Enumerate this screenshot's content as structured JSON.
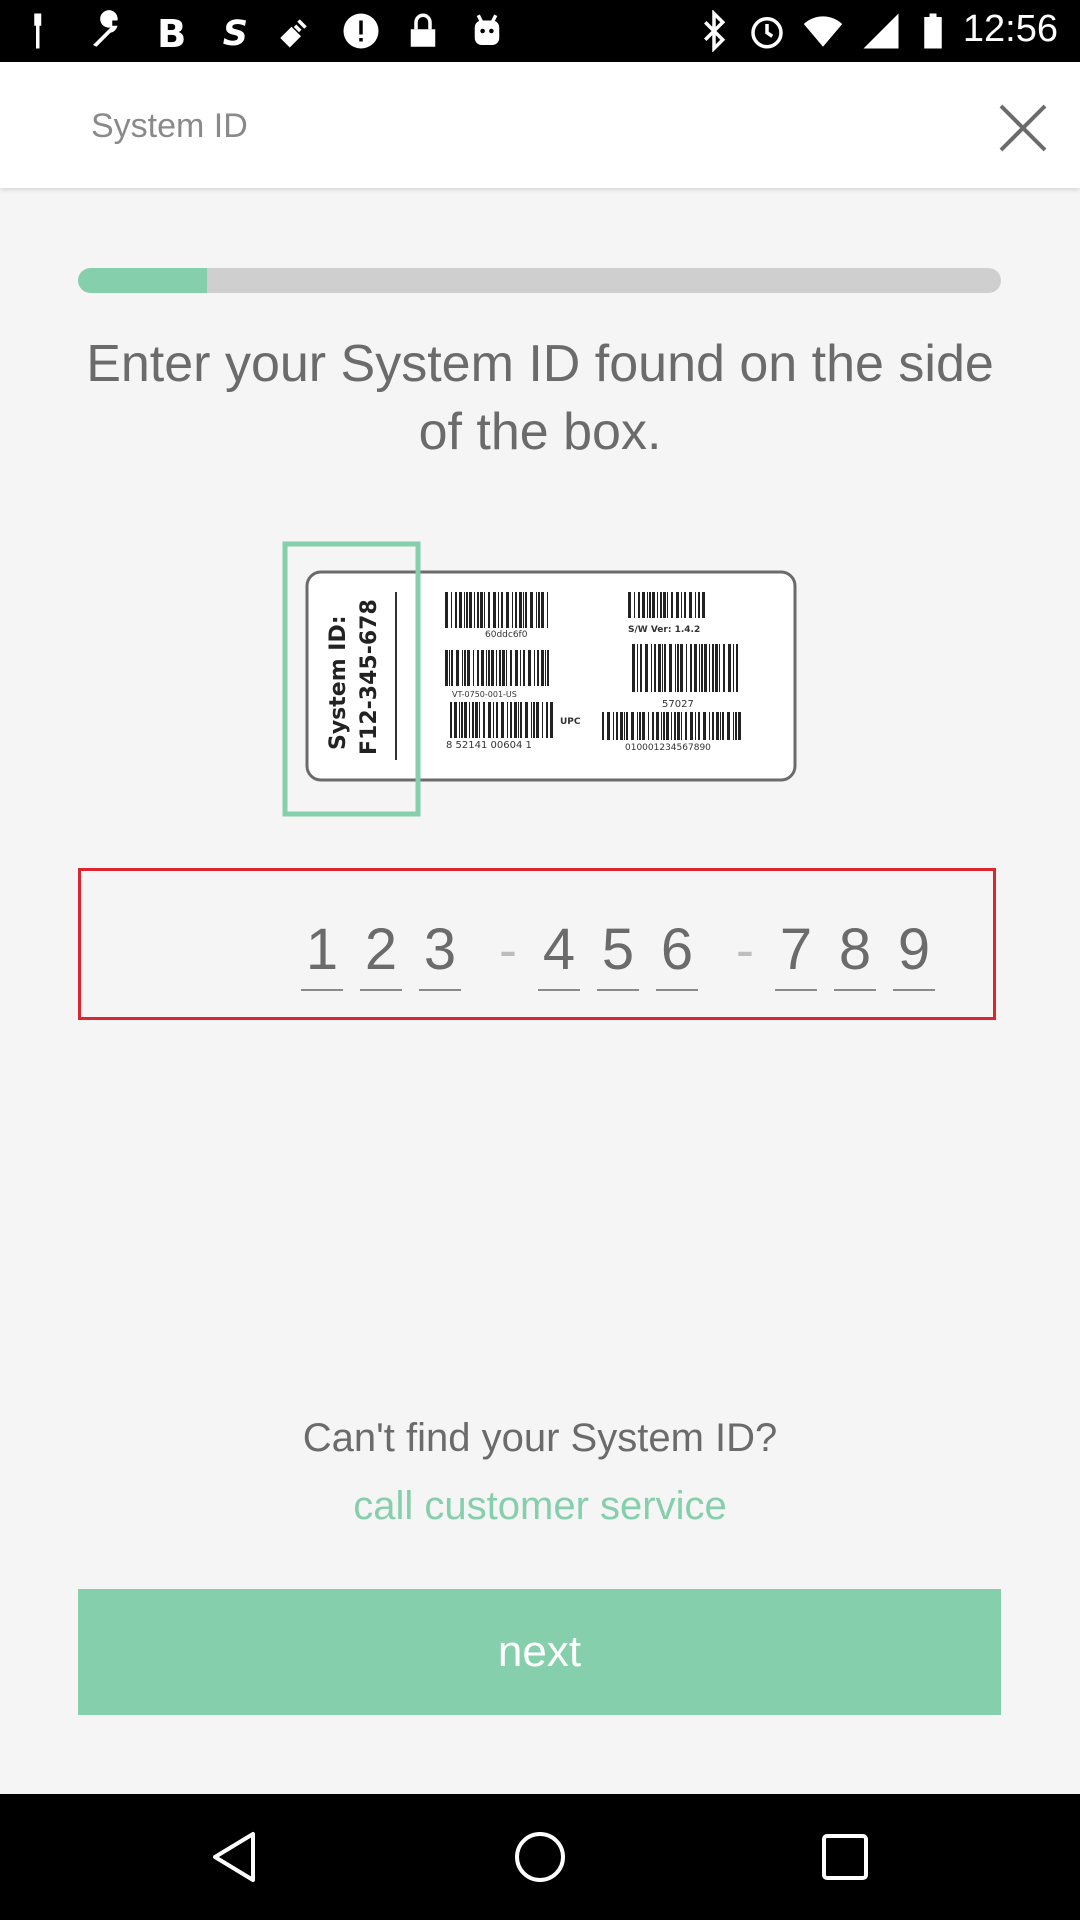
{
  "status_bar": {
    "time": "12:56",
    "left_icons": [
      "wrench-icon",
      "bold-b-icon",
      "s-logo-icon",
      "fake-gps-icon",
      "info-icon",
      "lock-icon",
      "android-icon"
    ],
    "right_icons": [
      "bluetooth-icon",
      "alarm-icon",
      "wifi-icon",
      "signal-icon",
      "battery-icon"
    ]
  },
  "header": {
    "title": "System ID",
    "close_icon": "close-icon"
  },
  "progress": {
    "value": 0.14,
    "color": "#86cfac",
    "track_color": "#cfcfcf"
  },
  "instruction": "Enter your System ID found on the side of the box.",
  "label": {
    "system_id_caption": "System ID:",
    "system_id_value": "F12-345-678",
    "barcode1_text": "60ddc6f0",
    "barcode2_text": "VT-0750-001-US",
    "upc_text": "UPC",
    "upc_number": "8  52141 00604  1",
    "sw_version": "S/W Ver: 1.4.2",
    "barcode4_text": "57027",
    "barcode5_text": "010001234567890"
  },
  "code_input": {
    "groups": [
      [
        "1",
        "2",
        "3"
      ],
      [
        "4",
        "5",
        "6"
      ],
      [
        "7",
        "8",
        "9"
      ]
    ],
    "separator": "-",
    "border_color": "#d9262f"
  },
  "help": {
    "question": "Can't find your System ID?",
    "link": "call customer service",
    "link_color": "#86cfac"
  },
  "next_button": {
    "label": "next",
    "color": "#86cfac"
  },
  "nav": {
    "icons": [
      "back-icon",
      "home-icon",
      "recents-icon"
    ]
  }
}
